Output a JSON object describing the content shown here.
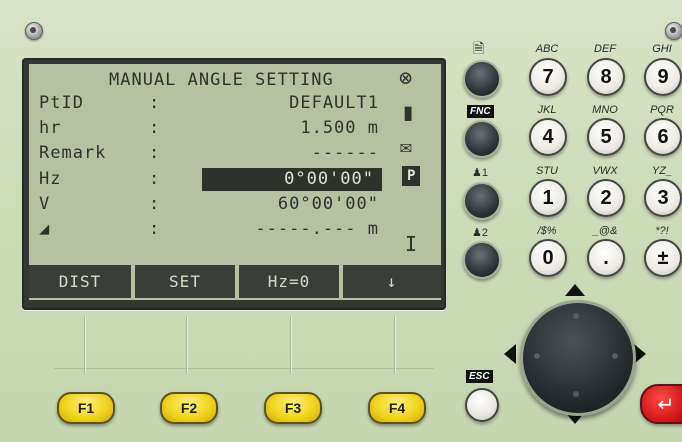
{
  "lcd": {
    "title": "MANUAL ANGLE SETTING",
    "rows": [
      {
        "label": "PtID",
        "value": "DEFAULT1"
      },
      {
        "label": "hr",
        "value": "1.500 m"
      },
      {
        "label": "Remark",
        "value": "------"
      },
      {
        "label": "Hz",
        "value": "0°00'00\""
      },
      {
        "label": "V",
        "value": "60°00'00\""
      },
      {
        "label": "◢",
        "value": "-----.--- m"
      }
    ],
    "colon": ":",
    "side_icons": {
      "compass": "⊗",
      "battery": "▮",
      "message": "✉",
      "p_badge": "P",
      "cursor": "I"
    },
    "softkeys": [
      "DIST",
      "SET",
      "Hz=0",
      "↓"
    ]
  },
  "fkeys": [
    "F1",
    "F2",
    "F3",
    "F4"
  ],
  "left_keys": {
    "page_icon": "🗎",
    "fnc": "FNC",
    "user1": "♟1",
    "user2": "♟2",
    "esc": "ESC"
  },
  "numpad": {
    "rows": [
      [
        {
          "alpha": "ABC",
          "key": "7"
        },
        {
          "alpha": "DEF",
          "key": "8"
        },
        {
          "alpha": "GHI",
          "key": "9"
        }
      ],
      [
        {
          "alpha": "JKL",
          "key": "4"
        },
        {
          "alpha": "MNO",
          "key": "5"
        },
        {
          "alpha": "PQR",
          "key": "6"
        }
      ],
      [
        {
          "alpha": "STU",
          "key": "1"
        },
        {
          "alpha": "VWX",
          "key": "2"
        },
        {
          "alpha": "YZ_",
          "key": "3"
        }
      ],
      [
        {
          "alpha": "/$%",
          "key": "0"
        },
        {
          "alpha": "_@&",
          "key": "."
        },
        {
          "alpha": "*?!",
          "key": "±"
        }
      ]
    ]
  },
  "enter_symbol": "↵",
  "colors": {
    "lcd_bg": "#b6c1a2",
    "lcd_text": "#2f332d",
    "fkey": "#f1d420",
    "enter": "#d11919"
  }
}
